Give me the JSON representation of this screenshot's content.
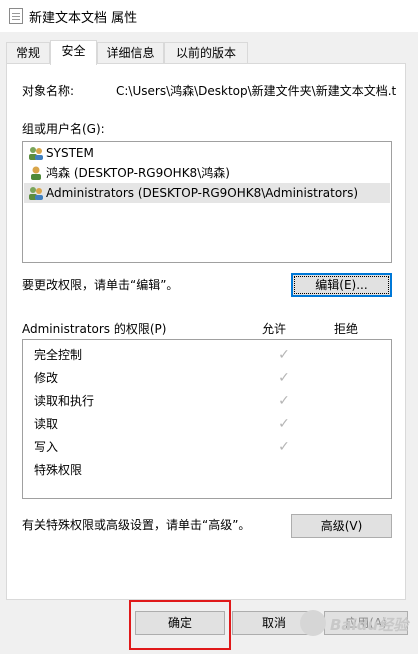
{
  "window": {
    "title": "新建文本文档 属性"
  },
  "tabs": [
    {
      "label": "常规"
    },
    {
      "label": "安全"
    },
    {
      "label": "详细信息"
    },
    {
      "label": "以前的版本"
    }
  ],
  "active_tab": "安全",
  "object": {
    "label": "对象名称:",
    "value": "C:\\Users\\鸿森\\Desktop\\新建文件夹\\新建文本文档.t"
  },
  "groups": {
    "label": "组或用户名(G):",
    "items": [
      {
        "name": "SYSTEM",
        "icon": "user-group-icon"
      },
      {
        "name": "鸿森 (DESKTOP-RG9OHK8\\鸿森)",
        "icon": "user-icon"
      },
      {
        "name": "Administrators (DESKTOP-RG9OHK8\\Administrators)",
        "icon": "user-group-icon",
        "selected": true
      }
    ]
  },
  "edit": {
    "hint": "要更改权限，请单击“编辑”。",
    "button": "编辑(E)..."
  },
  "permissions": {
    "label": "Administrators 的权限(P)",
    "allow_header": "允许",
    "deny_header": "拒绝",
    "rows": [
      {
        "name": "完全控制",
        "allow": true,
        "deny": false
      },
      {
        "name": "修改",
        "allow": true,
        "deny": false
      },
      {
        "name": "读取和执行",
        "allow": true,
        "deny": false
      },
      {
        "name": "读取",
        "allow": true,
        "deny": false
      },
      {
        "name": "写入",
        "allow": true,
        "deny": false
      },
      {
        "name": "特殊权限",
        "allow": false,
        "deny": false
      }
    ]
  },
  "advanced": {
    "hint": "有关特殊权限或高级设置，请单击“高级”。",
    "button": "高级(V)"
  },
  "footer": {
    "ok": "确定",
    "cancel": "取消",
    "apply": "应用(A)"
  },
  "watermark": "Baidu经验",
  "colors": {
    "highlight": "#e0191a",
    "selection": "#e5e5e5",
    "focus": "#0078d7"
  }
}
